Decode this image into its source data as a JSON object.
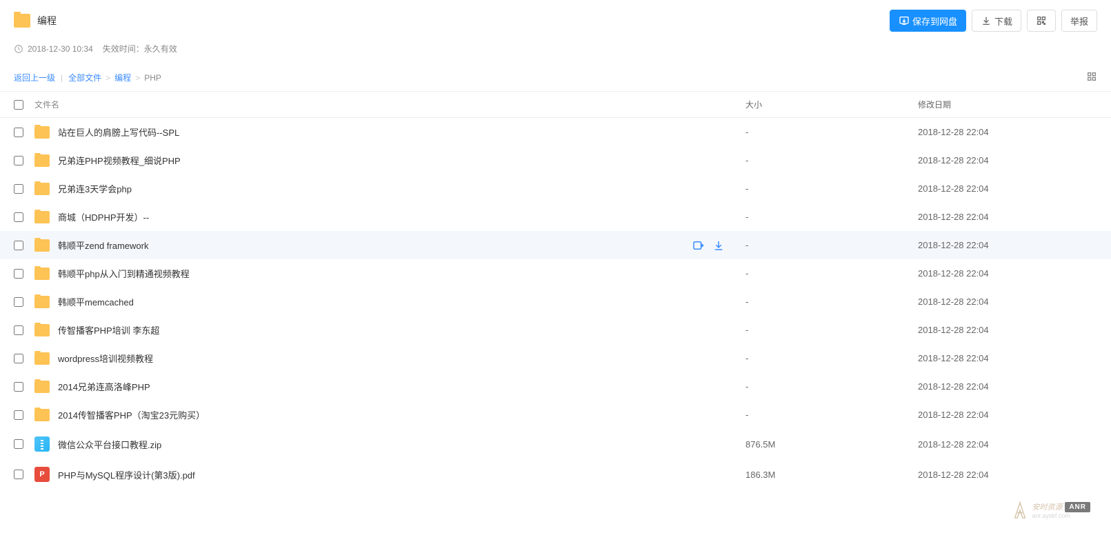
{
  "header": {
    "title": "编程",
    "save_button": "保存到网盘",
    "download_button": "下载",
    "report_button": "举报"
  },
  "meta": {
    "timestamp": "2018-12-30 10:34",
    "expire_label": "失效时间：永久有效"
  },
  "breadcrumb": {
    "back": "返回上一级",
    "all_files": "全部文件",
    "path1": "编程",
    "current": "PHP"
  },
  "columns": {
    "name": "文件名",
    "size": "大小",
    "date": "修改日期"
  },
  "rows": [
    {
      "type": "folder",
      "name": "站在巨人的肩膀上写代码--SPL",
      "size": "-",
      "date": "2018-12-28 22:04",
      "hovered": false
    },
    {
      "type": "folder",
      "name": "兄弟连PHP视频教程_细说PHP",
      "size": "-",
      "date": "2018-12-28 22:04",
      "hovered": false
    },
    {
      "type": "folder",
      "name": "兄弟连3天学会php",
      "size": "-",
      "date": "2018-12-28 22:04",
      "hovered": false
    },
    {
      "type": "folder",
      "name": "商城（HDPHP开发）--",
      "size": "-",
      "date": "2018-12-28 22:04",
      "hovered": false
    },
    {
      "type": "folder",
      "name": "韩顺平zend framework",
      "size": "-",
      "date": "2018-12-28 22:04",
      "hovered": true
    },
    {
      "type": "folder",
      "name": "韩顺平php从入门到精通视频教程",
      "size": "-",
      "date": "2018-12-28 22:04",
      "hovered": false
    },
    {
      "type": "folder",
      "name": "韩顺平memcached",
      "size": "-",
      "date": "2018-12-28 22:04",
      "hovered": false
    },
    {
      "type": "folder",
      "name": "传智播客PHP培训 李东超",
      "size": "-",
      "date": "2018-12-28 22:04",
      "hovered": false
    },
    {
      "type": "folder",
      "name": "wordpress培训视频教程",
      "size": "-",
      "date": "2018-12-28 22:04",
      "hovered": false
    },
    {
      "type": "folder",
      "name": "2014兄弟连高洛峰PHP",
      "size": "-",
      "date": "2018-12-28 22:04",
      "hovered": false
    },
    {
      "type": "folder",
      "name": "2014传智播客PHP（淘宝23元购买）",
      "size": "-",
      "date": "2018-12-28 22:04",
      "hovered": false
    },
    {
      "type": "zip",
      "name": "微信公众平台接口教程.zip",
      "size": "876.5M",
      "date": "2018-12-28 22:04",
      "hovered": false
    },
    {
      "type": "pdf",
      "name": "PHP与MySQL程序设计(第3版).pdf",
      "size": "186.3M",
      "date": "2018-12-28 22:04",
      "hovered": false
    }
  ],
  "watermark": {
    "text": "安时资源",
    "tag": "ANR",
    "url": "anr.ayskf.com"
  }
}
